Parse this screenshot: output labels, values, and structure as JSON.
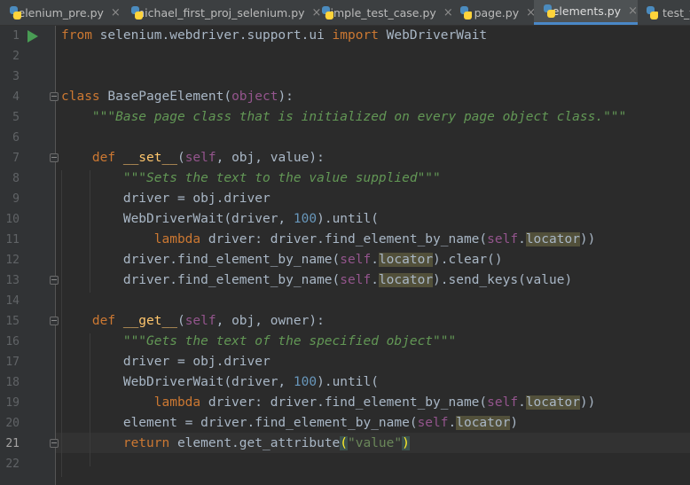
{
  "tabs": [
    {
      "label": "selenium_pre.py"
    },
    {
      "label": "michael_first_proj_selenium.py"
    },
    {
      "label": "simple_test_case.py"
    },
    {
      "label": "page.py"
    },
    {
      "label": "elements.py"
    },
    {
      "label": "test_te"
    }
  ],
  "active_tab": "elements.py",
  "close_glyph": "×",
  "lines": [
    {
      "n": "1"
    },
    {
      "n": "2"
    },
    {
      "n": "3"
    },
    {
      "n": "4"
    },
    {
      "n": "5"
    },
    {
      "n": "6"
    },
    {
      "n": "7"
    },
    {
      "n": "8"
    },
    {
      "n": "9"
    },
    {
      "n": "10"
    },
    {
      "n": "11"
    },
    {
      "n": "12"
    },
    {
      "n": "13"
    },
    {
      "n": "14"
    },
    {
      "n": "15"
    },
    {
      "n": "16"
    },
    {
      "n": "17"
    },
    {
      "n": "18"
    },
    {
      "n": "19"
    },
    {
      "n": "20"
    },
    {
      "n": "21"
    },
    {
      "n": "22"
    }
  ],
  "code": {
    "l1": {
      "a": "from",
      "b": " selenium.webdriver.support.ui ",
      "c": "import",
      "d": " WebDriverWait"
    },
    "l4": {
      "a": "class",
      "b": " BasePageElement(",
      "c": "object",
      "d": "):"
    },
    "l5": {
      "a": "    \"\"\"Base page class that is initialized on every page object class.\"\"\""
    },
    "l7": {
      "a": "    def",
      "b": " __set__",
      "c": "(",
      "d": "self",
      "e": ", obj, value):"
    },
    "l8": {
      "a": "        \"\"\"Sets the text to the value supplied\"\"\""
    },
    "l9": {
      "a": "        driver = obj.driver"
    },
    "l10": {
      "a": "        WebDriverWait(driver, ",
      "b": "100",
      "c": ").until("
    },
    "l11": {
      "a": "            lambda",
      "b": " driver: driver.find_element_by_name(",
      "c": "self",
      "d": ".",
      "e": "locator",
      "f": "))"
    },
    "l12": {
      "a": "        driver.find_element_by_name(",
      "b": "self",
      "c": ".",
      "d": "locator",
      "e": ").clear()"
    },
    "l13": {
      "a": "        driver.find_element_by_name(",
      "b": "self",
      "c": ".",
      "d": "locator",
      "e": ").send_keys(value)"
    },
    "l15": {
      "a": "    def",
      "b": " __get__",
      "c": "(",
      "d": "self",
      "e": ", obj, owner):"
    },
    "l16": {
      "a": "        \"\"\"Gets the text of the specified object\"\"\""
    },
    "l17": {
      "a": "        driver = obj.driver"
    },
    "l18": {
      "a": "        WebDriverWait(driver, ",
      "b": "100",
      "c": ").until("
    },
    "l19": {
      "a": "            lambda",
      "b": " driver: driver.find_element_by_name(",
      "c": "self",
      "d": ".",
      "e": "locator",
      "f": "))"
    },
    "l20": {
      "a": "        element = driver.find_element_by_name(",
      "b": "self",
      "c": ".",
      "d": "locator",
      "e": ")"
    },
    "l21": {
      "a": "        return",
      "b": " element.get_attribute",
      "c": "(",
      "d": "\"value\"",
      "e": ")"
    }
  }
}
